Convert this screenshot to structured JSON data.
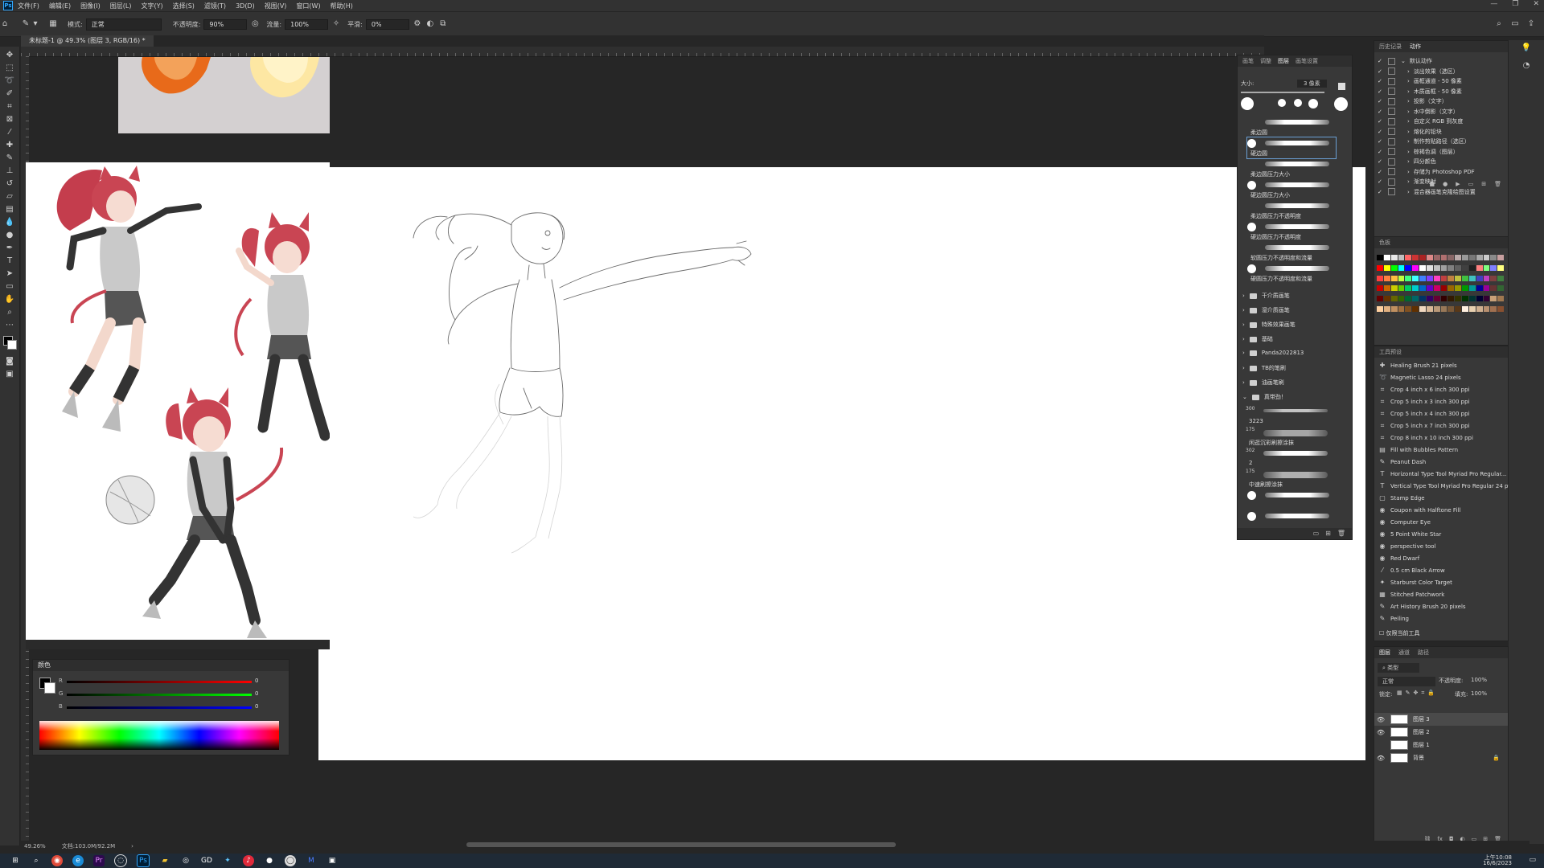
{
  "menubar": {
    "items": [
      "文件(F)",
      "编辑(E)",
      "图像(I)",
      "图层(L)",
      "文字(Y)",
      "选择(S)",
      "滤镜(T)",
      "3D(D)",
      "视图(V)",
      "窗口(W)",
      "帮助(H)"
    ]
  },
  "options_bar": {
    "mode_label": "模式:",
    "mode_value": "正常",
    "opacity_label": "不透明度:",
    "opacity_value": "90%",
    "flow_label": "流量:",
    "flow_value": "100%",
    "smoothing_label": "平滑:",
    "smoothing_value": "0%"
  },
  "document_tab": {
    "title": "未标题-1 @ 49.3% (图层 3, RGB/16) *"
  },
  "color_panel": {
    "title": "颜色",
    "sliders": [
      {
        "label": "R",
        "value": "0",
        "color": "#e02020"
      },
      {
        "label": "G",
        "value": "0",
        "color": "#20c020"
      },
      {
        "label": "B",
        "value": "0",
        "color": "#2030e0"
      }
    ]
  },
  "brush_panel": {
    "tabs": [
      "画笔",
      "调整",
      "图层",
      "画笔设置"
    ],
    "size_label": "大小:",
    "size_value": "3 像素",
    "brushes": [
      "柔边圆",
      "硬边圆",
      "柔边圆压力大小",
      "硬边圆压力大小",
      "柔边圆压力不透明度",
      "硬边圆压力不透明度",
      "软圆压力不透明度和流量",
      "硬圆压力不透明度和流量"
    ],
    "folders": [
      "干介质画笔",
      "湿介质画笔",
      "特殊效果画笔",
      "基础",
      "Panda2022813",
      "TB的笔刷",
      "油画笔刷",
      "真带劲！"
    ],
    "sub_brushes": [
      {
        "size": "300",
        "name": "3223"
      },
      {
        "size": "175",
        "name": "闲逛沉彩刷擦涂抹"
      },
      {
        "size": "302",
        "name": "2"
      },
      {
        "size": "175",
        "name": "中速刷擦涂抹"
      }
    ]
  },
  "history_panel": {
    "tabs": [
      "历史记录",
      "动作"
    ],
    "items": [
      "默认动作",
      "淡出效果（选区）",
      "画框通道 - 50 像素",
      "木质画框 - 50 像素",
      "投影（文字）",
      "水中倒影（文字）",
      "自定义 RGB 到灰度",
      "熔化的铅块",
      "制作剪贴路径（选区）",
      "棕褐色调（图层）",
      "四分颜色",
      "存储为 Photoshop PDF",
      "渐变映射",
      "混合器画笔克隆绘图设置"
    ]
  },
  "swatches_panel": {
    "title": "色板",
    "colors": [
      "#000000",
      "#ffffff",
      "#e8e8e8",
      "#c0c0c0",
      "#ff6666",
      "#cc3333",
      "#aa2222",
      "#dd8888",
      "#996666",
      "#b07070",
      "#886666",
      "#bbaaaa",
      "#999999",
      "#777777",
      "#aaaaaa",
      "#cccccc",
      "#8a8a8a",
      "#c8a0a0",
      "#ff0000",
      "#ffff00",
      "#00ff00",
      "#00ffff",
      "#0000ff",
      "#ff00ff",
      "#ffffff",
      "#e0e0e0",
      "#c0c0c0",
      "#a0a0a0",
      "#808080",
      "#606060",
      "#404040",
      "#202020",
      "#ff8080",
      "#80ff80",
      "#8080ff",
      "#ffff80",
      "#ff4040",
      "#ff8040",
      "#ffc040",
      "#c0ff40",
      "#40ff80",
      "#40ffff",
      "#4080ff",
      "#8040ff",
      "#ff40c0",
      "#c04040",
      "#c08040",
      "#c0c040",
      "#40c040",
      "#40c0c0",
      "#4040c0",
      "#c040c0",
      "#804040",
      "#408040",
      "#cc0000",
      "#cc6600",
      "#cccc00",
      "#66cc00",
      "#00cc66",
      "#00cccc",
      "#0066cc",
      "#6600cc",
      "#cc0066",
      "#990000",
      "#996600",
      "#999900",
      "#009900",
      "#009999",
      "#000099",
      "#990099",
      "#663333",
      "#336633",
      "#660000",
      "#663300",
      "#666600",
      "#336600",
      "#006633",
      "#006666",
      "#003366",
      "#330066",
      "#660033",
      "#330000",
      "#331a00",
      "#333300",
      "#003300",
      "#003333",
      "#000033",
      "#330033",
      "#c8a078",
      "#a07850",
      "#ffd0a0",
      "#e0b080",
      "#c09060",
      "#a07040",
      "#805020",
      "#603000",
      "#f0d8c0",
      "#d8b898",
      "#b89878",
      "#987858",
      "#785838",
      "#583818",
      "#fff0e0",
      "#e8d0b0",
      "#d0b090",
      "#b89070",
      "#a07050",
      "#885030"
    ]
  },
  "tool_presets": {
    "title": "工具预设",
    "items": [
      "Healing Brush 21 pixels",
      "Magnetic Lasso 24 pixels",
      "Crop 4 inch x 6 inch 300 ppi",
      "Crop 5 inch x 3 inch 300 ppi",
      "Crop 5 inch x 4 inch 300 ppi",
      "Crop 5 inch x 7 inch 300 ppi",
      "Crop 8 inch x 10 inch 300 ppi",
      "Fill with Bubbles Pattern",
      "Peanut Dash",
      "Horizontal Type Tool Myriad Pro Regular...",
      "Vertical Type Tool Myriad Pro Regular 24 pt",
      "Stamp Edge",
      "Coupon with Halftone Fill",
      "Computer Eye",
      "5 Point White Star",
      "perspective tool",
      "Red Dwarf",
      "0.5 cm Black Arrow",
      "Starburst Color Target",
      "Stitched Patchwork",
      "Art History Brush 20 pixels",
      "Peiling"
    ],
    "footer": "仅限当前工具"
  },
  "layers_panel": {
    "tabs": [
      "图层",
      "通道",
      "路径"
    ],
    "search": "类型",
    "blend_mode": "正常",
    "opacity_label": "不透明度:",
    "opacity_value": "100%",
    "lock_label": "锁定:",
    "fill_label": "填充:",
    "fill_value": "100%",
    "layers": [
      {
        "name": "图层 3",
        "visible": true,
        "selected": true
      },
      {
        "name": "图层 2",
        "visible": true,
        "selected": false
      },
      {
        "name": "图层 1",
        "visible": false,
        "selected": false
      },
      {
        "name": "背景",
        "visible": true,
        "selected": false
      }
    ]
  },
  "status_bar": {
    "zoom": "49.26%",
    "doc_info": "文档:103.0M/92.2M"
  },
  "taskbar": {
    "time": "上午10:08",
    "date": "16/6/2023"
  }
}
